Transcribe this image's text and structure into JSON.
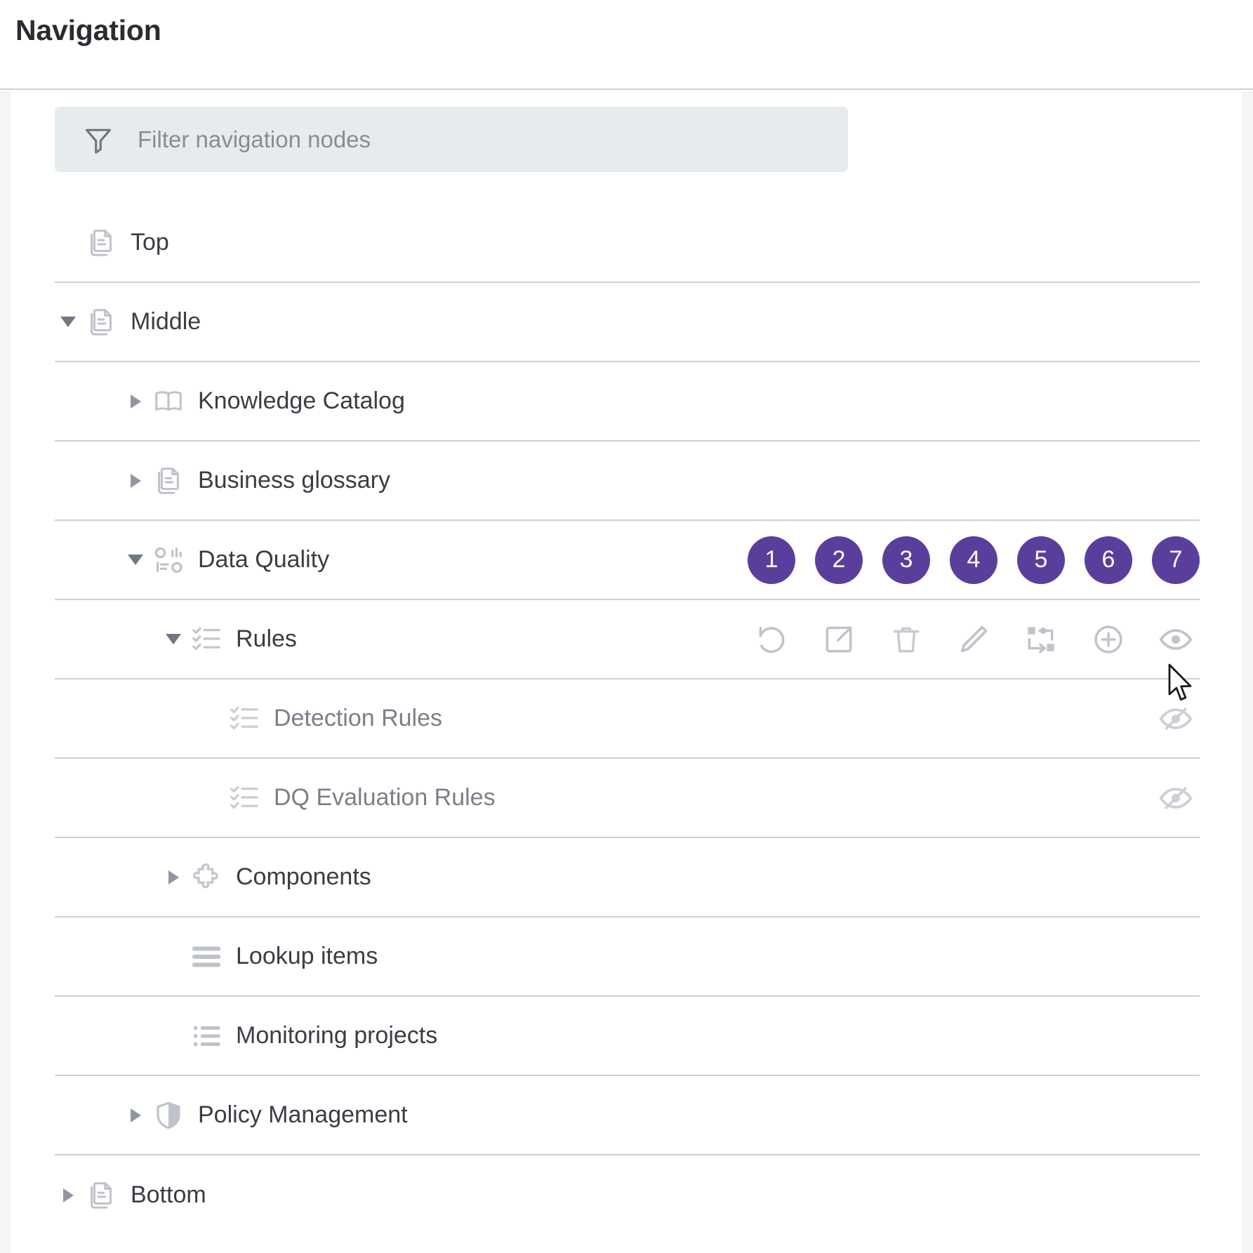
{
  "header": {
    "title": "Navigation"
  },
  "filter": {
    "icon": "filter-icon",
    "placeholder": "Filter navigation nodes",
    "value": ""
  },
  "colors": {
    "badge_background": "#5b3e9c",
    "badge_text": "#ffffff",
    "row_divider": "#c6d3dd",
    "filter_background": "#e6ecee",
    "icon_gray": "#b9bcc2",
    "label_text": "#3b3d45",
    "label_muted": "#7c7f88"
  },
  "badges": [
    {
      "label": "1"
    },
    {
      "label": "2"
    },
    {
      "label": "3"
    },
    {
      "label": "4"
    },
    {
      "label": "5"
    },
    {
      "label": "6"
    },
    {
      "label": "7"
    }
  ],
  "action_icons": [
    {
      "name": "restore-icon"
    },
    {
      "name": "open-external-icon"
    },
    {
      "name": "delete-icon"
    },
    {
      "name": "edit-icon"
    },
    {
      "name": "move-icon"
    },
    {
      "name": "add-icon"
    },
    {
      "name": "visibility-icon"
    }
  ],
  "tree": [
    {
      "label": "Top",
      "icon": "documents-icon",
      "level": 0,
      "expander": "none"
    },
    {
      "label": "Middle",
      "icon": "documents-icon",
      "level": 0,
      "expander": "expanded"
    },
    {
      "label": "Knowledge Catalog",
      "icon": "book-icon",
      "level": 1,
      "expander": "collapsed"
    },
    {
      "label": "Business glossary",
      "icon": "documents-icon",
      "level": 1,
      "expander": "collapsed"
    },
    {
      "label": "Data Quality",
      "icon": "data-quality-icon",
      "level": 1,
      "expander": "expanded"
    },
    {
      "label": "Rules",
      "icon": "checklist-icon",
      "level": 2,
      "expander": "expanded"
    },
    {
      "label": "Detection Rules",
      "icon": "checklist-icon",
      "level": 3,
      "expander": "none",
      "muted": true,
      "hidden_badge": "visibility-off-icon"
    },
    {
      "label": "DQ Evaluation Rules",
      "icon": "checklist-icon",
      "level": 3,
      "expander": "none",
      "muted": true,
      "hidden_badge": "visibility-off-icon"
    },
    {
      "label": "Components",
      "icon": "puzzle-icon",
      "level": 2,
      "expander": "collapsed"
    },
    {
      "label": "Lookup items",
      "icon": "list-bars-icon",
      "level": 2,
      "expander": "none"
    },
    {
      "label": "Monitoring projects",
      "icon": "bulleted-list-icon",
      "level": 2,
      "expander": "none"
    },
    {
      "label": "Policy Management",
      "icon": "shield-icon",
      "level": 1,
      "expander": "collapsed"
    },
    {
      "label": "Bottom",
      "icon": "documents-icon",
      "level": 0,
      "expander": "collapsed"
    }
  ],
  "cursor": {
    "name": "mouse-pointer"
  }
}
